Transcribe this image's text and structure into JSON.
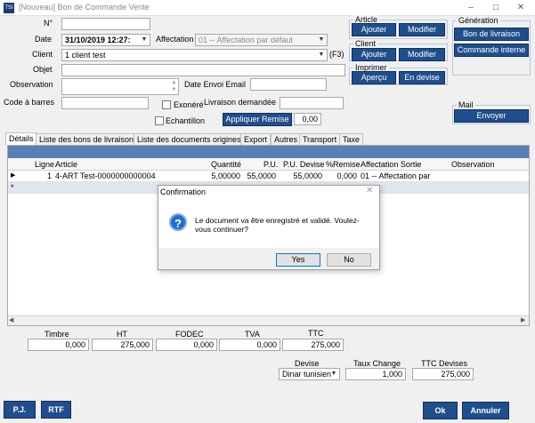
{
  "window": {
    "app_icon_text": "TSI",
    "title": "[Nouveau] Bon de Commande Vente"
  },
  "form": {
    "no_label": "N°",
    "no_value": "",
    "date_label": "Date",
    "date_value": "31/10/2019 12:27:",
    "affectation_label": "Affectation",
    "affectation_value": "01 -- Affectation par défaut",
    "client_label": "Client",
    "client_value": "1 client test",
    "client_shortcut": "(F3)",
    "objet_label": "Objet",
    "objet_value": "",
    "observation_label": "Observation",
    "observation_value": "",
    "date_envoi_label": "Date Envoi Email",
    "date_envoi_value": "",
    "code_barres_label": "Code à barres",
    "code_barres_value": "",
    "exonere_label": "Exonéré",
    "livraison_label": "Livraison demandée",
    "livraison_value": "",
    "echantillon_label": "Echantillon",
    "remise_button": "Appliquer Remise",
    "remise_value": "0,00"
  },
  "article_group": {
    "title": "Article",
    "add": "Ajouter",
    "edit": "Modifier"
  },
  "client_group": {
    "title": "Client",
    "add": "Ajouter",
    "edit": "Modifier"
  },
  "print_group": {
    "title": "Imprimer",
    "preview": "Aperçu",
    "currency": "En devise"
  },
  "generation_group": {
    "title": "Génération",
    "delivery": "Bon de livraison",
    "internal": "Commande interne"
  },
  "mail_group": {
    "title": "Mail",
    "send": "Envoyer"
  },
  "tabs": [
    {
      "label": "Détails"
    },
    {
      "label": "Liste des bons de livraison"
    },
    {
      "label": "Liste des documents origines"
    },
    {
      "label": "Export"
    },
    {
      "label": "Autres"
    },
    {
      "label": "Transport"
    },
    {
      "label": "Taxe"
    }
  ],
  "grid": {
    "columns": [
      "Ligne",
      "Article",
      "Quantité",
      "P.U.",
      "P.U. Devise",
      "%Remise",
      "Affectation Sortie",
      "Observation"
    ],
    "row": {
      "ligne": "1",
      "article": "4-ART Test-0000000000004",
      "quantite": "5,00000",
      "pu": "55,0000",
      "pu_devise": "55,0000",
      "remise": "0,000",
      "affectation": "01 -- Affectation par",
      "observation": ""
    },
    "new_row_marker": "*",
    "current_row_marker": "▶"
  },
  "totals": {
    "timbre_label": "Timbre",
    "timbre_value": "0,000",
    "ht_label": "HT",
    "ht_value": "275,000",
    "fodec_label": "FODEC",
    "fodec_value": "0,000",
    "tva_label": "TVA",
    "tva_value": "0,000",
    "ttc_label": "TTC",
    "ttc_value": "275,000",
    "devise_label": "Devise",
    "devise_value": "Dinar tunisien",
    "taux_label": "Taux Change",
    "taux_value": "1,000",
    "ttc_devises_label": "TTC Devises",
    "ttc_devises_value": "275,000"
  },
  "footer": {
    "pj": "P.J.",
    "rtf": "RTF",
    "ok": "Ok",
    "cancel": "Annuler"
  },
  "dialog": {
    "title": "Confirmation",
    "message": "Le document va être enregistré et validé. Voulez-vous continuer?",
    "yes": "Yes",
    "no": "No"
  },
  "colors": {
    "accent": "#1f4e8c",
    "grid_header": "#5a7fb5",
    "info_icon": "#1e6fd0"
  }
}
